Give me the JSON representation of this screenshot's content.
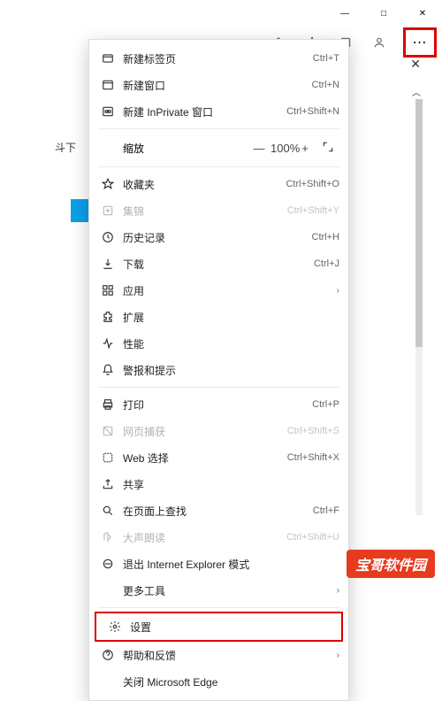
{
  "titlebar": {
    "min": "—",
    "max": "□",
    "close": "✕"
  },
  "toolbar": {
    "more": "⋯"
  },
  "left_label": "斗下",
  "menu": {
    "new_tab": {
      "label": "新建标签页",
      "shortcut": "Ctrl+T"
    },
    "new_window": {
      "label": "新建窗口",
      "shortcut": "Ctrl+N"
    },
    "new_inprivate": {
      "label": "新建 InPrivate 窗口",
      "shortcut": "Ctrl+Shift+N"
    },
    "zoom": {
      "label": "缩放",
      "value": "100%",
      "minus": "—",
      "plus": "+"
    },
    "favorites": {
      "label": "收藏夹",
      "shortcut": "Ctrl+Shift+O"
    },
    "collections": {
      "label": "集锦",
      "shortcut": "Ctrl+Shift+Y"
    },
    "history": {
      "label": "历史记录",
      "shortcut": "Ctrl+H"
    },
    "downloads": {
      "label": "下载",
      "shortcut": "Ctrl+J"
    },
    "apps": {
      "label": "应用"
    },
    "extensions": {
      "label": "扩展"
    },
    "performance": {
      "label": "性能"
    },
    "alerts": {
      "label": "警报和提示"
    },
    "print": {
      "label": "打印",
      "shortcut": "Ctrl+P"
    },
    "capture": {
      "label": "网页捕获",
      "shortcut": "Ctrl+Shift+S"
    },
    "web_select": {
      "label": "Web 选择",
      "shortcut": "Ctrl+Shift+X"
    },
    "share": {
      "label": "共享"
    },
    "find": {
      "label": "在页面上查找",
      "shortcut": "Ctrl+F"
    },
    "read_aloud": {
      "label": "大声朗读",
      "shortcut": "Ctrl+Shift+U"
    },
    "exit_ie": {
      "label": "退出 Internet Explorer 模式"
    },
    "more_tools": {
      "label": "更多工具"
    },
    "settings": {
      "label": "设置"
    },
    "help": {
      "label": "帮助和反馈"
    },
    "close_edge": {
      "label": "关闭 Microsoft Edge"
    }
  },
  "watermark": "宝哥软件园"
}
